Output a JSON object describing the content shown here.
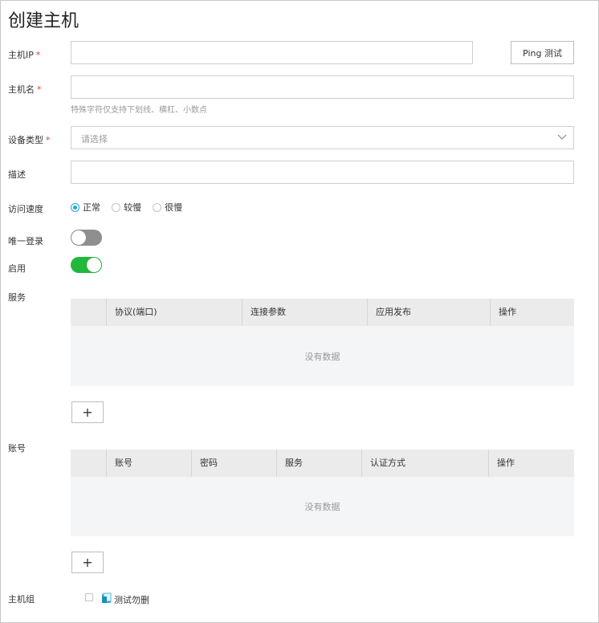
{
  "title": "创建主机",
  "fields": {
    "host_ip": {
      "label": "主机IP",
      "required_mark": "*",
      "value": ""
    },
    "ping_button": "Ping 测试",
    "host_name": {
      "label": "主机名",
      "required_mark": "*",
      "value": "",
      "hint": "特殊字符仅支持下划线、横杠、小数点"
    },
    "device_type": {
      "label": "设备类型",
      "required_mark": "*",
      "placeholder": "请选择"
    },
    "description": {
      "label": "描述",
      "value": ""
    },
    "access_speed": {
      "label": "访问速度",
      "options": [
        "正常",
        "较慢",
        "很慢"
      ],
      "selected": "正常"
    },
    "unique_login": {
      "label": "唯一登录",
      "on": false
    },
    "enabled": {
      "label": "启用",
      "on": true
    }
  },
  "services": {
    "label": "服务",
    "columns": [
      "协议(端口)",
      "连接参数",
      "应用发布",
      "操作"
    ],
    "empty_text": "没有数据",
    "add_label": "+"
  },
  "accounts": {
    "label": "账号",
    "columns": [
      "账号",
      "密码",
      "服务",
      "认证方式",
      "操作"
    ],
    "empty_text": "没有数据",
    "add_label": "+"
  },
  "host_group": {
    "label": "主机组",
    "items": [
      {
        "name": "测试勿删",
        "checked": false
      }
    ]
  },
  "colors": {
    "accent": "#1ea6e0",
    "toggle_on": "#21b83b",
    "toggle_off": "#8f8f8f",
    "required": "#e4393c"
  }
}
